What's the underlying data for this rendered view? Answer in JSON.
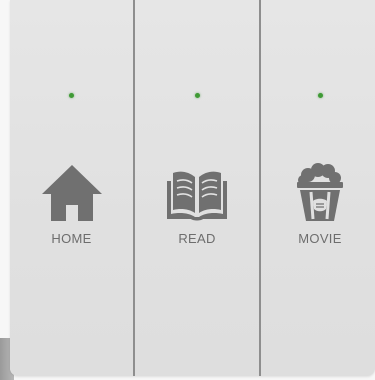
{
  "colors": {
    "led": "#3f9a35",
    "icon": "#707070",
    "label": "#6d6d6d",
    "divider": "#8e8e8e"
  },
  "keys": [
    {
      "label": "HOME",
      "icon": "house-icon",
      "led_on": true
    },
    {
      "label": "READ",
      "icon": "open-book-icon",
      "led_on": true
    },
    {
      "label": "MOVIE",
      "icon": "popcorn-icon",
      "led_on": true
    }
  ]
}
